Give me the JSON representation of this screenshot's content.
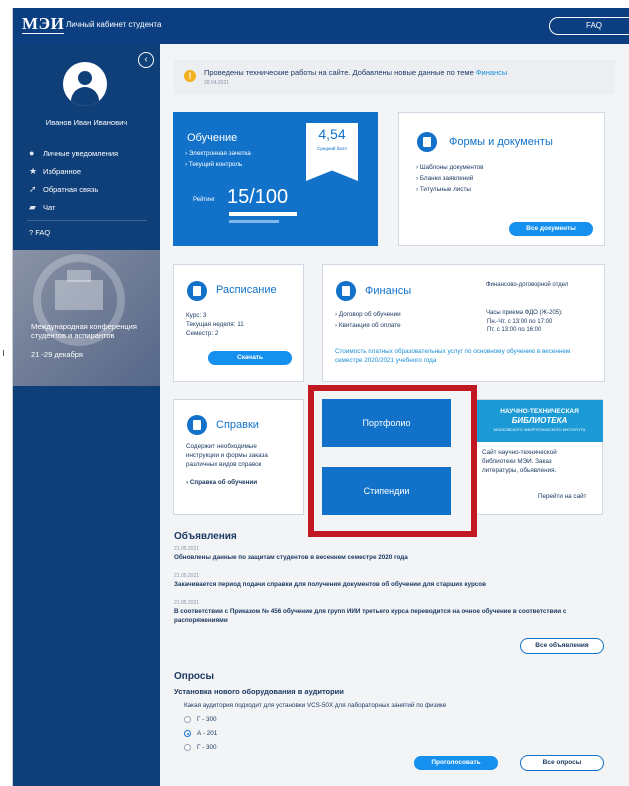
{
  "header": {
    "logo": "МЭИ",
    "title": "Личный кабинет студента",
    "faq": "FAQ"
  },
  "sidebar": {
    "collapse_icon": "‹",
    "user_name": "Иванов Иван Иванович",
    "items": [
      {
        "icon": "info-icon",
        "glyph": "●",
        "label": "Личные уведомления"
      },
      {
        "icon": "star-icon",
        "glyph": "★",
        "label": "Избранное"
      },
      {
        "icon": "send-icon",
        "glyph": "➚",
        "label": "Обратная связь"
      },
      {
        "icon": "chat-icon",
        "glyph": "▰",
        "label": "Чат"
      }
    ],
    "faq": "?   FAQ",
    "banner": {
      "title": "Международная конференция студентов и аспирантов",
      "date": "21 -29 декабря"
    }
  },
  "notice": {
    "text": "Проведены технические работы на сайте. Добавлены новые данные по теме ",
    "link": "Финансы",
    "date": "28.04.2021"
  },
  "study": {
    "title": "Обучение",
    "links": [
      "Электронная зачетка",
      "Текущий контроль"
    ],
    "gpa": "4,54",
    "gpa_label": "Средний балл",
    "rating_label": "Рейтинг",
    "rating_value": "15/100",
    "rating_fraction": 0.15
  },
  "documents": {
    "title": "Формы и документы",
    "links": [
      "Шаблоны документов",
      "Бланки заявлений",
      "Титульные листы"
    ],
    "button": "Все документы"
  },
  "schedule": {
    "title": "Расписание",
    "lines": [
      "Курс: 3",
      "Текущая неделя: 11",
      "Семестр: 2"
    ],
    "button": "Скачать"
  },
  "finance": {
    "title": "Финансы",
    "links": [
      "Договор об обучении",
      "Квитанция об оплате"
    ],
    "dept_title": "Финансово-договорной отдел",
    "hours_title": "Часы приема ФДО (Ж-205):",
    "hours_1": "Пн.-Чт. с 13:00 по 17:00",
    "hours_2": "Пт. с 13:00 по 16:00",
    "cost_text": "Стоимость платных образовательных услуг по основному обучению в весеннем семестре 2020/2021 учебного года"
  },
  "certificates": {
    "title": "Справки",
    "description": "Содержит необходимые инструкции и формы заказа различных видов справок",
    "link": "Справка об обучении"
  },
  "portfolio": {
    "label": "Портфолио"
  },
  "scholarship": {
    "label": "Стипендии"
  },
  "library": {
    "head_line1": "НАУЧНО-ТЕХНИЧЕСКАЯ",
    "head_line2": "БИБЛИОТЕКА",
    "head_line3": "МОСКОВСКОГО ЭНЕРГЕТИЧЕСКОГО ИНСТИТУТА",
    "text": "Сайт научно-технической библиотеки МЭИ. Заказ литературы, обьявления.",
    "link": "Перейти на сайт"
  },
  "announcements": {
    "title": "Объявления",
    "items": [
      {
        "date": "21.05.2021",
        "text": "Обновлены данные по защитам студентов в весеннем семестре 2020 года"
      },
      {
        "date": "21.05.2021",
        "text": "Закачивается период подачи справки для получения документов об обучении для старших курсов"
      },
      {
        "date": "21.05.2021",
        "text": "В соответствии с Приказом № 456 обучение для групп ИИИ третьего курса переводится на очное обучение в соответствии с распоряжениями"
      }
    ],
    "all_button": "Все объявления"
  },
  "polls": {
    "title": "Опросы",
    "question": "Установка нового оборудования в аудитории",
    "subquestion": "Какая аудитория подходит для установки VCS-50X для лабораторных занятий по физике",
    "options": [
      "Г - 300",
      "А - 201",
      "Г - 300"
    ],
    "selected_index": 1,
    "vote_button": "Проголосовать",
    "all_button": "Все опросы"
  },
  "colors": {
    "primary": "#1272c9",
    "sidebar": "#0e3f79",
    "highlight": "#c11921",
    "accent_button": "#1590ee"
  }
}
